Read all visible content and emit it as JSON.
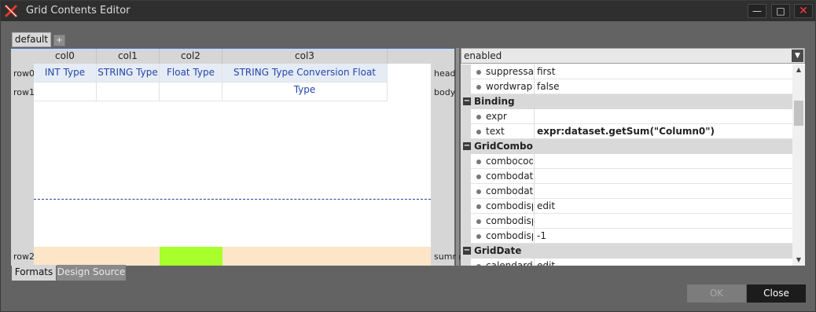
{
  "window": {
    "title": "Grid Contents Editor"
  },
  "format_tabs": {
    "active": "default",
    "add_label": "+"
  },
  "grid": {
    "columns": [
      "col0",
      "col1",
      "col2",
      "col3"
    ],
    "row_labels": [
      "row0",
      "row1",
      "row2"
    ],
    "band_labels": [
      "head",
      "body",
      "summ"
    ],
    "row0_cells": [
      "INT Type",
      "STRING Type",
      "Float Type",
      "STRING Type Conversion Float Type"
    ],
    "colors": {
      "head_cell": "#e6ecf6",
      "summary_row": "#fde5c8",
      "selected_summary_cell": "#a8ff2c"
    }
  },
  "bottom_tabs": [
    "Formats",
    "Design Source"
  ],
  "properties": {
    "combo_value": "enabled",
    "rows": [
      {
        "kind": "prop",
        "name": "suppressalign",
        "value": "first"
      },
      {
        "kind": "prop",
        "name": "wordwrap",
        "value": "false"
      },
      {
        "kind": "group",
        "name": "Binding"
      },
      {
        "kind": "prop",
        "name": "expr",
        "value": ""
      },
      {
        "kind": "prop",
        "name": "text",
        "value": "expr:dataset.getSum(\"Column0\")",
        "bold": true
      },
      {
        "kind": "group",
        "name": "GridCombo"
      },
      {
        "kind": "prop",
        "name": "combocodecol",
        "value": ""
      },
      {
        "kind": "prop",
        "name": "combodataset",
        "value": ""
      },
      {
        "kind": "prop",
        "name": "combodatacol",
        "value": ""
      },
      {
        "kind": "prop",
        "name": "combodisplay",
        "value": "edit"
      },
      {
        "kind": "prop",
        "name": "combodisplaynulltext",
        "value": ""
      },
      {
        "kind": "prop",
        "name": "combodisplayrowcount",
        "value": "-1"
      },
      {
        "kind": "group",
        "name": "GridDate"
      },
      {
        "kind": "prop",
        "name": "calendardisplay",
        "value": "edit"
      }
    ]
  },
  "buttons": {
    "ok": "OK",
    "close": "Close"
  }
}
